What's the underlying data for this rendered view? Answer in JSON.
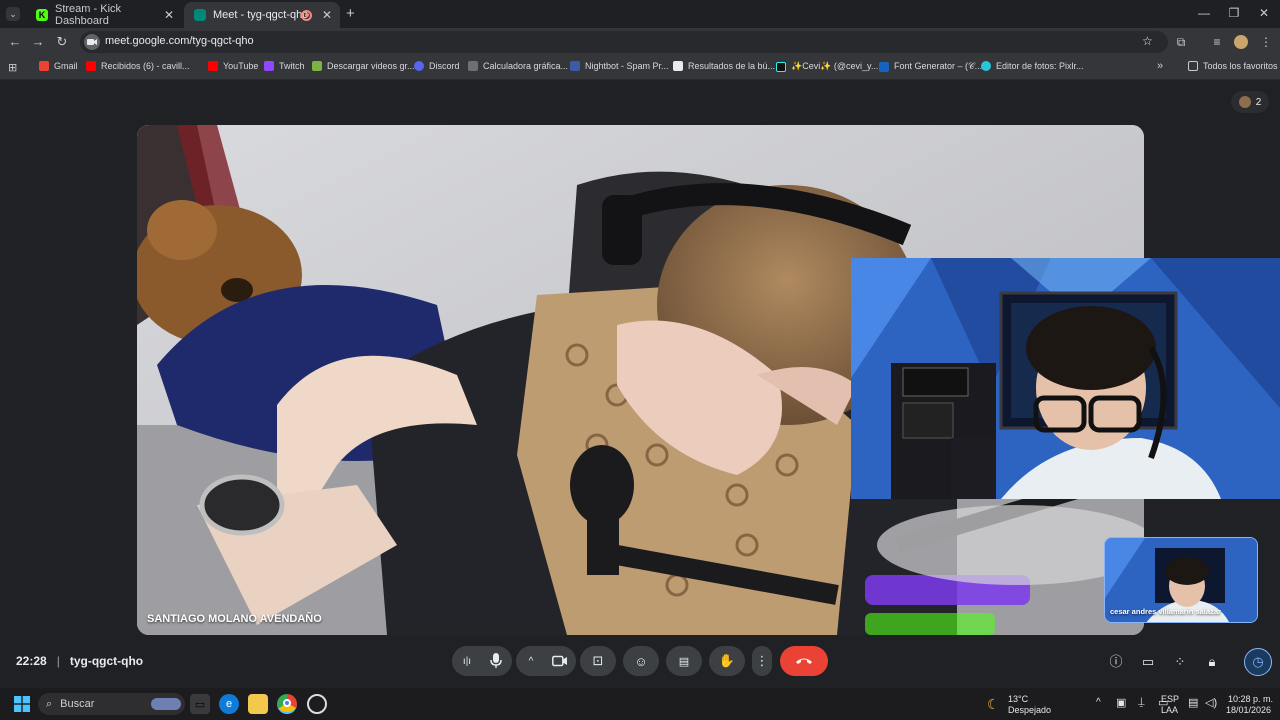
{
  "browser": {
    "tabs": [
      {
        "title": "Stream - Kick Dashboard",
        "active": false
      },
      {
        "title": "Meet - tyg-qgct-qho",
        "active": true
      }
    ],
    "url": "meet.google.com/tyg-qgct-qho",
    "bookmarks": [
      "Gmail",
      "Recibidos (6) - cavill...",
      "YouTube",
      "Twitch",
      "Descargar videos gr...",
      "Discord",
      "Calculadora gráfica...",
      "Nightbot - Spam Pr...",
      "Resultados de la bú...",
      "✨Cevi✨ (@cevi_y...",
      "Font Generator – (𝒞...",
      "Editor de fotos: Pixlr..."
    ],
    "all_bookmarks": "Todos los favoritos"
  },
  "meet": {
    "participant_count": "2",
    "main_participant": "SANTIAGO MOLANO AVENDAÑO",
    "self_name": "cesar andres villamarin salazar",
    "time": "22:28",
    "meeting_code": "tyg-qgct-qho"
  },
  "taskbar": {
    "search_placeholder": "Buscar",
    "weather_temp": "13°C",
    "weather_desc": "Despejado",
    "lang_1": "ESP",
    "lang_2": "LAA",
    "clock_time": "10:28 p. m.",
    "clock_date": "18/01/2026"
  },
  "colors": {
    "hangup": "#ea4335",
    "accent": "#8ab4f8",
    "kick_green": "#53fc18"
  }
}
